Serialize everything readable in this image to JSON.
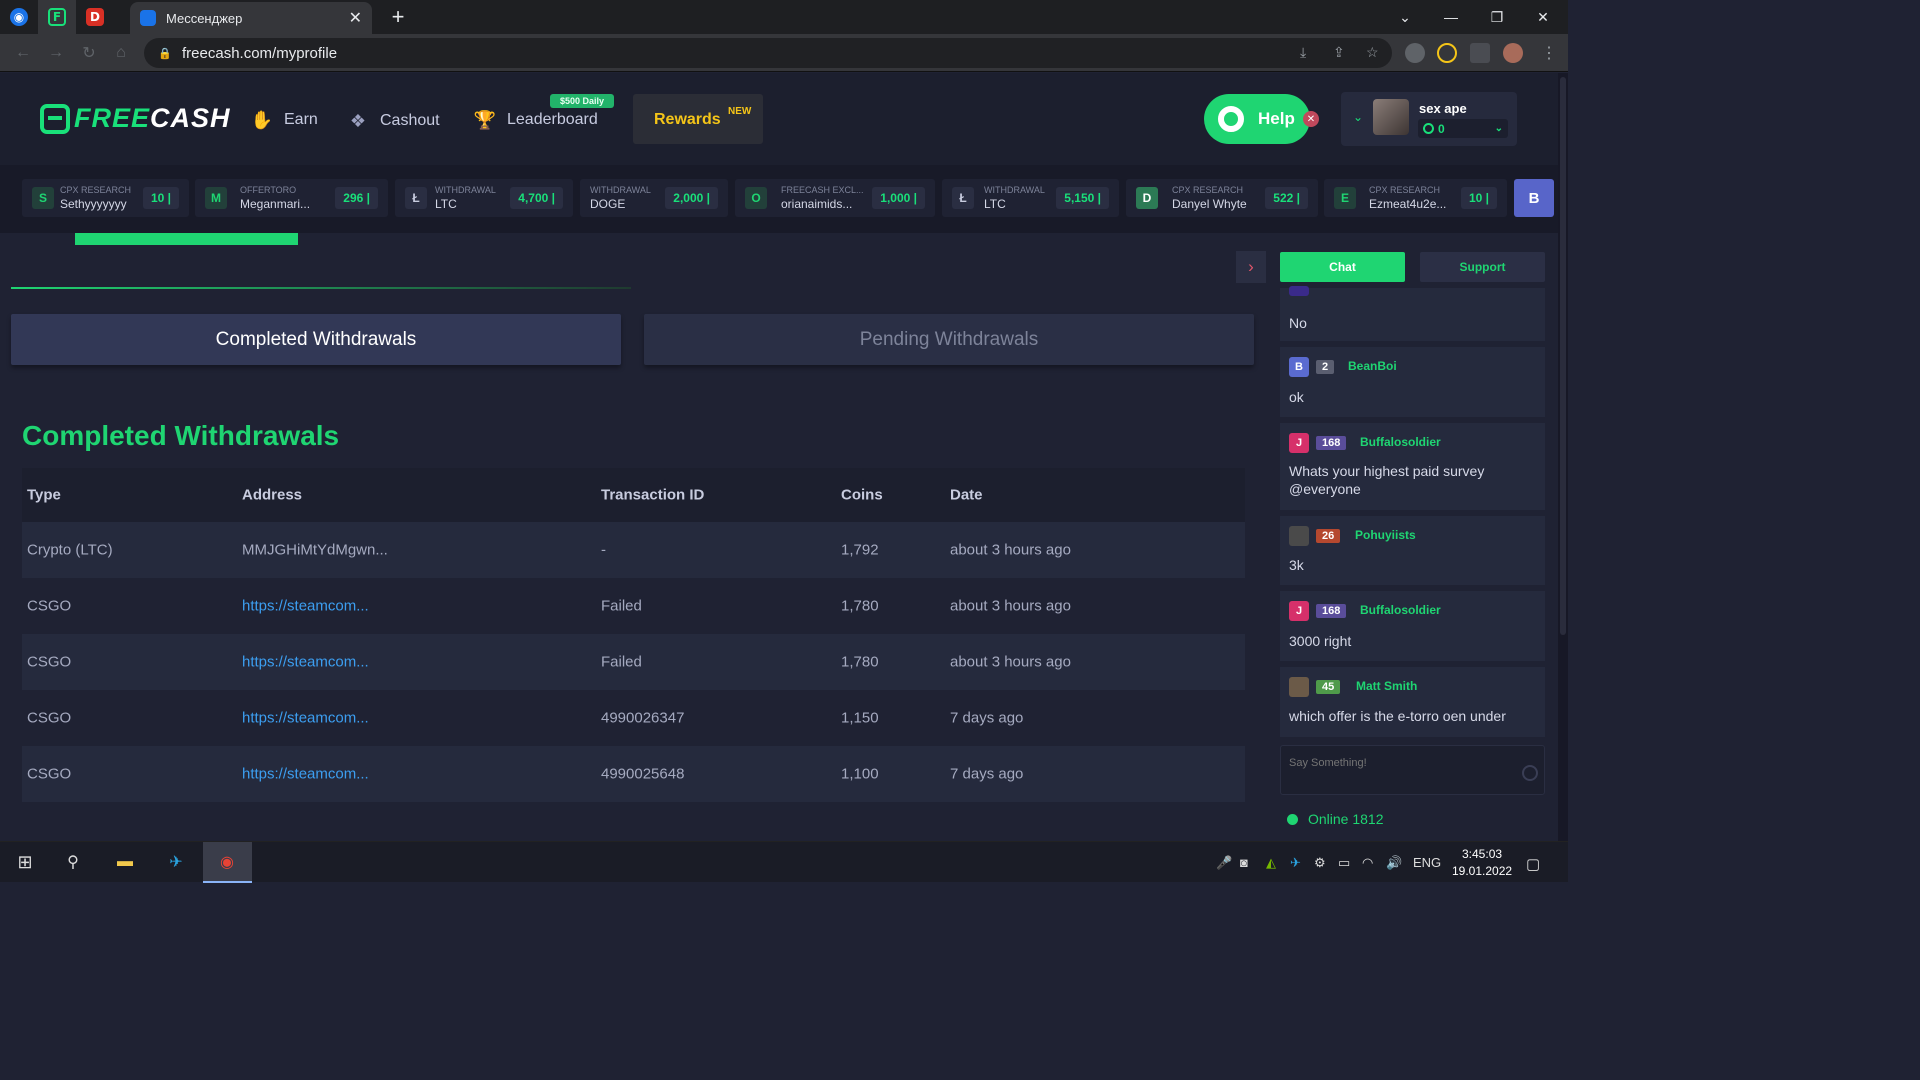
{
  "browser": {
    "active_tab_title": "Мессенджер",
    "url": "freecash.com/myprofile"
  },
  "header": {
    "logo_part1": "FREE",
    "logo_part2": "CASH",
    "nav": {
      "earn": "Earn",
      "cashout": "Cashout",
      "leaderboard": "Leaderboard",
      "leaderboard_badge": "$500 Daily",
      "rewards": "Rewards",
      "rewards_badge": "NEW"
    },
    "help_label": "Help",
    "user": {
      "name": "sex ape",
      "balance": "0"
    }
  },
  "ticker": [
    {
      "avatar": "S",
      "source": "CPX RESEARCH",
      "user": "Sethyyyyyyy",
      "amount": "10 |"
    },
    {
      "avatar": "M",
      "source": "OFFERTORO",
      "user": "Meganmari...",
      "amount": "296 |"
    },
    {
      "avatar": "Ł",
      "source": "WITHDRAWAL",
      "user": "LTC",
      "amount": "4,700 |"
    },
    {
      "avatar": "",
      "source": "WITHDRAWAL",
      "user": "DOGE",
      "amount": "2,000 |"
    },
    {
      "avatar": "O",
      "source": "FREECASH EXCL...",
      "user": "orianaimids...",
      "amount": "1,000 |"
    },
    {
      "avatar": "Ł",
      "source": "WITHDRAWAL",
      "user": "LTC",
      "amount": "5,150 |"
    },
    {
      "avatar": "D",
      "source": "CPX RESEARCH",
      "user": "Danyel Whyte",
      "amount": "522 |"
    },
    {
      "avatar": "E",
      "source": "CPX RESEARCH",
      "user": "Ezmeat4u2e...",
      "amount": "10 |"
    },
    {
      "avatar": "B",
      "source": "",
      "user": "",
      "amount": ""
    }
  ],
  "tabs": {
    "completed": "Completed Withdrawals",
    "pending": "Pending Withdrawals"
  },
  "section_title": "Completed Withdrawals",
  "table": {
    "headers": [
      "Type",
      "Address",
      "Transaction ID",
      "Coins",
      "Date"
    ],
    "rows": [
      {
        "type": "Crypto (LTC)",
        "address": "MMJGHiMtYdMgwn...",
        "txid": "-",
        "coins": "1,792",
        "date": "about 3 hours ago",
        "link": false
      },
      {
        "type": "CSGO",
        "address": "https://steamcom...",
        "txid": "Failed",
        "coins": "1,780",
        "date": "about 3 hours ago",
        "link": true
      },
      {
        "type": "CSGO",
        "address": "https://steamcom...",
        "txid": "Failed",
        "coins": "1,780",
        "date": "about 3 hours ago",
        "link": true
      },
      {
        "type": "CSGO",
        "address": "https://steamcom...",
        "txid": "4990026347",
        "coins": "1,150",
        "date": "7 days ago",
        "link": true
      },
      {
        "type": "CSGO",
        "address": "https://steamcom...",
        "txid": "4990025648",
        "coins": "1,100",
        "date": "7 days ago",
        "link": true
      }
    ]
  },
  "chat": {
    "chat_tab": "Chat",
    "support_tab": "Support",
    "messages": [
      {
        "avatar": "",
        "level": "",
        "user": "",
        "text": "No"
      },
      {
        "avatar": "B",
        "level": "2",
        "user": "BeanBoi",
        "text": "ok"
      },
      {
        "avatar": "J",
        "level": "168",
        "user": "Buffalosoldier",
        "text": "Whats your highest paid survey @everyone"
      },
      {
        "avatar": "",
        "level": "26",
        "user": "Pohuyiists",
        "text": "3k"
      },
      {
        "avatar": "J",
        "level": "168",
        "user": "Buffalosoldier",
        "text": "3000 right"
      },
      {
        "avatar": "",
        "level": "45",
        "user": "Matt Smith",
        "text": "which offer is the e-torro oen under"
      }
    ],
    "input_placeholder": "Say Something!",
    "online": "Online 1812"
  },
  "taskbar": {
    "lang": "ENG",
    "time": "3:45:03",
    "date": "19.01.2022"
  },
  "colors": {
    "accent": "#1fd572",
    "gold": "#f5c518",
    "link": "#3c9ef0",
    "bg": "#1f2233"
  }
}
